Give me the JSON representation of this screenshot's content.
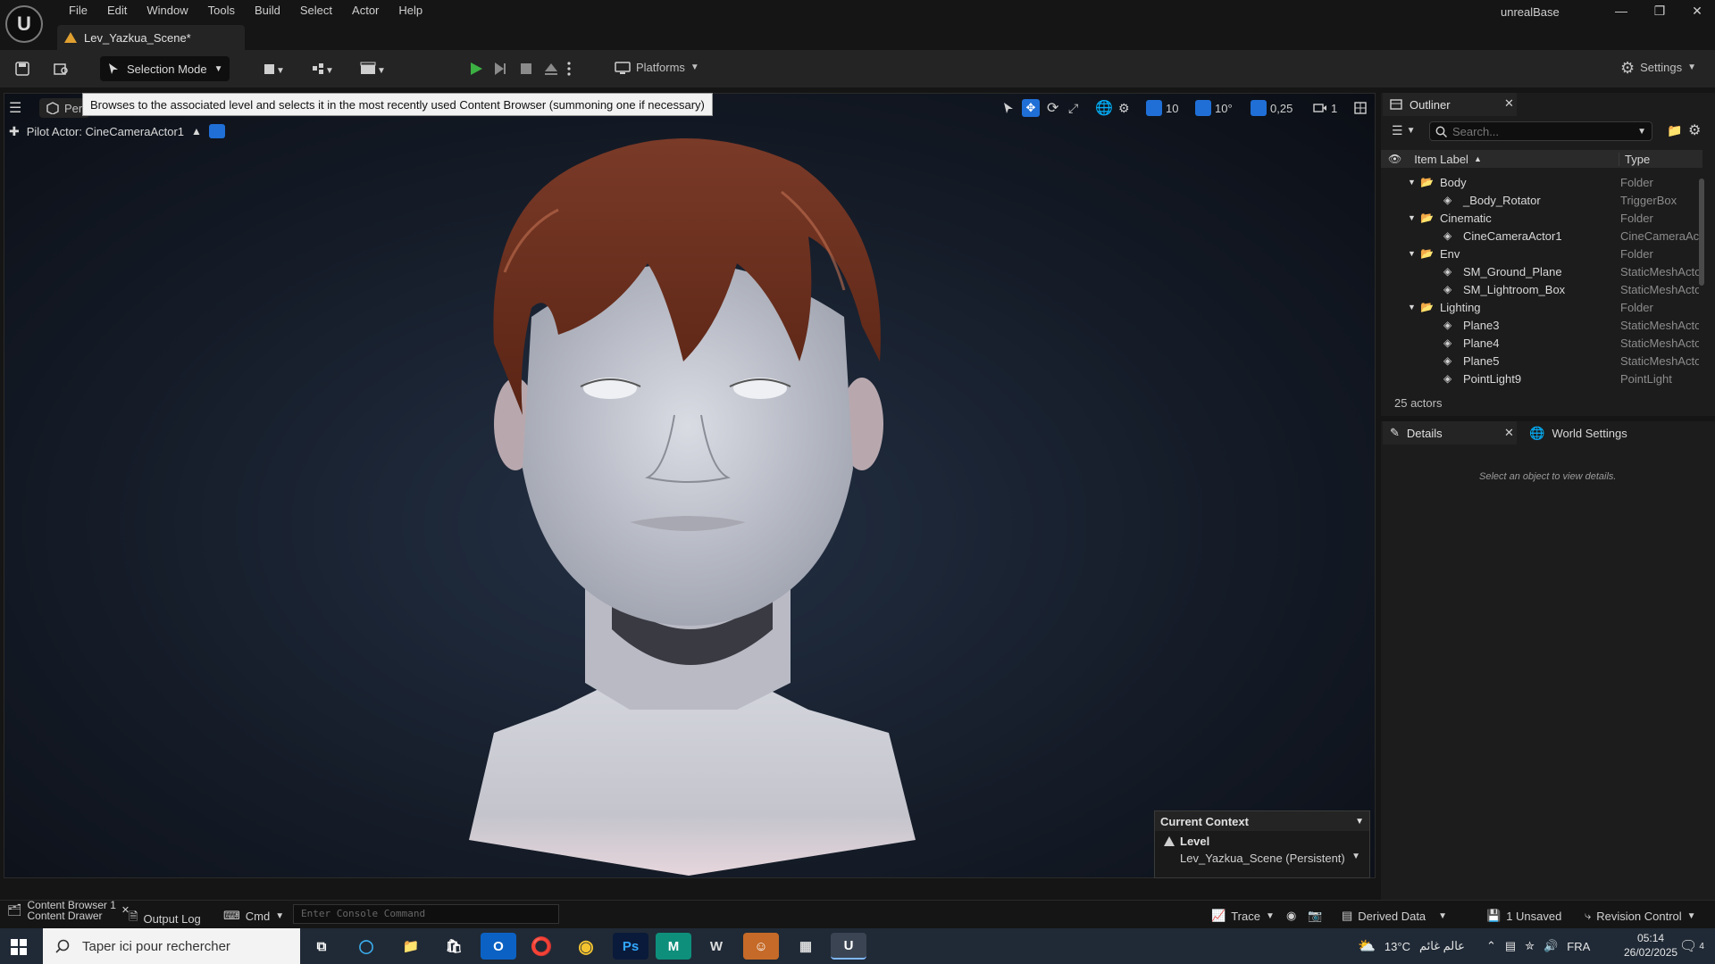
{
  "app": {
    "title": "unrealBase",
    "menu": [
      "File",
      "Edit",
      "Window",
      "Tools",
      "Build",
      "Select",
      "Actor",
      "Help"
    ],
    "logo_text": "U"
  },
  "level_tab": {
    "label": "Lev_Yazkua_Scene*"
  },
  "toolbar": {
    "selection_mode": "Selection Mode",
    "platforms": "Platforms",
    "settings": "Settings"
  },
  "viewport": {
    "perspective_label": "Per",
    "tooltip": "Browses to the associated level and selects it in the most recently used Content Browser (summoning one if necessary)",
    "pilot_actor": "Pilot Actor: CineCameraActor1",
    "grid_snap": "10",
    "rotation_snap": "10°",
    "scale_snap": "0,25",
    "camera_speed": "1"
  },
  "context_panel": {
    "title": "Current Context",
    "level_label": "Level",
    "level_name": "Lev_Yazkua_Scene (Persistent)"
  },
  "outliner": {
    "tab_label": "Outliner",
    "search_placeholder": "Search...",
    "col_label": "Item Label",
    "col_type": "Type",
    "rows": [
      {
        "label": "Body",
        "type": "Folder",
        "folder": true
      },
      {
        "label": "_Body_Rotator",
        "type": "TriggerBox",
        "folder": false
      },
      {
        "label": "Cinematic",
        "type": "Folder",
        "folder": true
      },
      {
        "label": "CineCameraActor1",
        "type": "CineCameraAc",
        "folder": false
      },
      {
        "label": "Env",
        "type": "Folder",
        "folder": true
      },
      {
        "label": "SM_Ground_Plane",
        "type": "StaticMeshActo",
        "folder": false
      },
      {
        "label": "SM_Lightroom_Box",
        "type": "StaticMeshActo",
        "folder": false
      },
      {
        "label": "Lighting",
        "type": "Folder",
        "folder": true
      },
      {
        "label": "Plane3",
        "type": "StaticMeshActo",
        "folder": false
      },
      {
        "label": "Plane4",
        "type": "StaticMeshActo",
        "folder": false
      },
      {
        "label": "Plane5",
        "type": "StaticMeshActo",
        "folder": false
      },
      {
        "label": "PointLight9",
        "type": "PointLight",
        "folder": false
      }
    ],
    "actor_count": "25 actors"
  },
  "details": {
    "tab_label": "Details",
    "world_settings": "World Settings",
    "empty_text": "Select an object to view details."
  },
  "statusbar": {
    "content_browser": "Content Browser 1",
    "content_drawer": "Content Drawer",
    "output_log": "Output Log",
    "cmd": "Cmd",
    "console_placeholder": "Enter Console Command",
    "trace": "Trace",
    "derived_data": "Derived Data",
    "unsaved": "1 Unsaved",
    "revision_control": "Revision Control"
  },
  "taskbar": {
    "search_placeholder": "Taper ici pour rechercher",
    "weather": "13°C",
    "weather_text": "عالم غائم",
    "language": "FRA",
    "time": "05:14",
    "date": "26/02/2025",
    "notifications": "4"
  },
  "colors": {
    "accent_blue": "#1f6fd6",
    "play_green": "#3cb043",
    "panel_bg": "#1c1c1c",
    "toolbar_bg": "#242424"
  }
}
